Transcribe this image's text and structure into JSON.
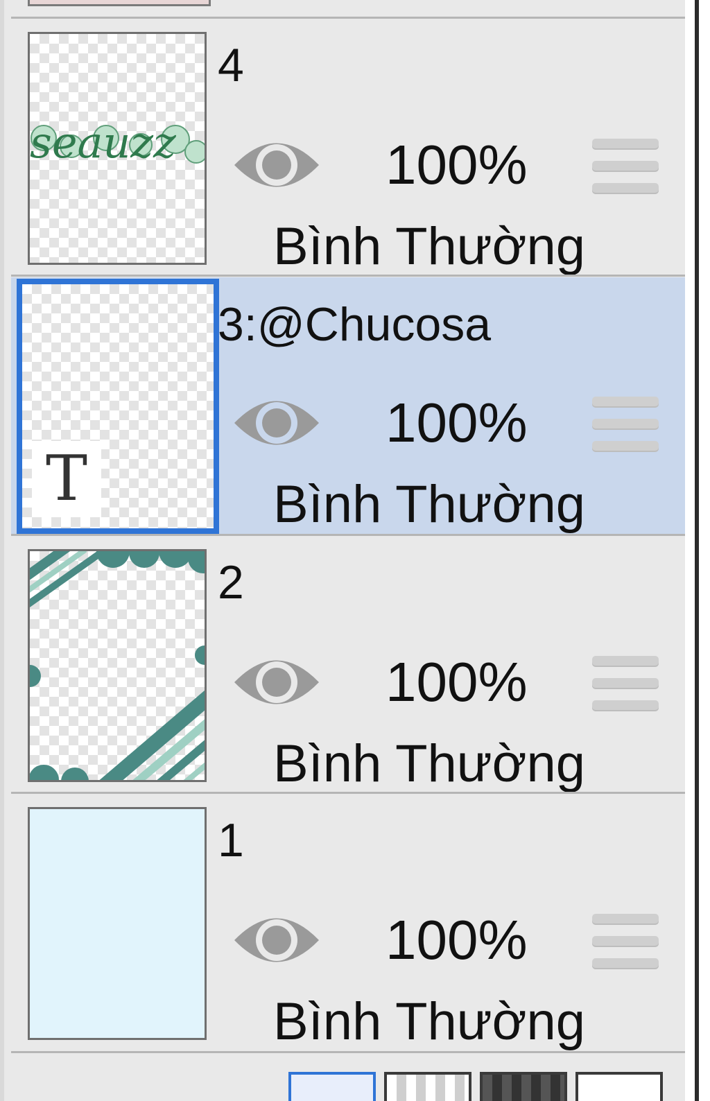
{
  "layers": [
    {
      "name": "4",
      "opacity": "100%",
      "blend_mode": "Bình Thường",
      "thumbnail_text": "seauzz",
      "selected": false
    },
    {
      "name": "3:@Chucosa",
      "opacity": "100%",
      "blend_mode": "Bình Thường",
      "thumbnail_text": "T",
      "selected": true
    },
    {
      "name": "2",
      "opacity": "100%",
      "blend_mode": "Bình Thường",
      "selected": false
    },
    {
      "name": "1",
      "opacity": "100%",
      "blend_mode": "Bình Thường",
      "selected": false
    }
  ],
  "colors": {
    "selected_bg": "#c9d7ec",
    "selected_border": "#2f74d6",
    "layer1_fill": "#e1f4fc",
    "teal": "#4a8a84",
    "mint": "#9fd0c3"
  },
  "icons": {
    "visibility": "eye-icon",
    "drag": "drag-handle-icon"
  }
}
